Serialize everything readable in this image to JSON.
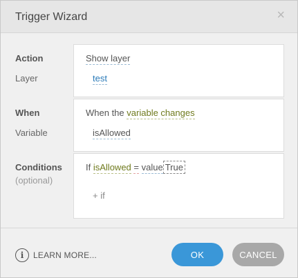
{
  "window": {
    "title": "Trigger Wizard",
    "close_glyph": "×"
  },
  "action_section": {
    "label": "Action",
    "sublabel": "Layer",
    "action_value": "Show layer",
    "layer_value": "test"
  },
  "when_section": {
    "label": "When",
    "sublabel": "Variable",
    "prefix": "When the",
    "condition_value": "variable changes",
    "variable_value": "isAllowed"
  },
  "conditions_section": {
    "label": "Conditions",
    "sublabel": "(optional)",
    "if_text": "If",
    "variable": "isAllowed",
    "operator": "=",
    "value_type": "value",
    "value": "True",
    "add_if": "+ if"
  },
  "footer": {
    "learn_more": "LEARN MORE...",
    "ok_label": "OK",
    "cancel_label": "CANCEL"
  },
  "colors": {
    "ok_button": "#3a97d8",
    "cancel_button": "#a8a8a8",
    "link_blue": "#2a7ab8",
    "link_olive": "#6f7a1d"
  }
}
